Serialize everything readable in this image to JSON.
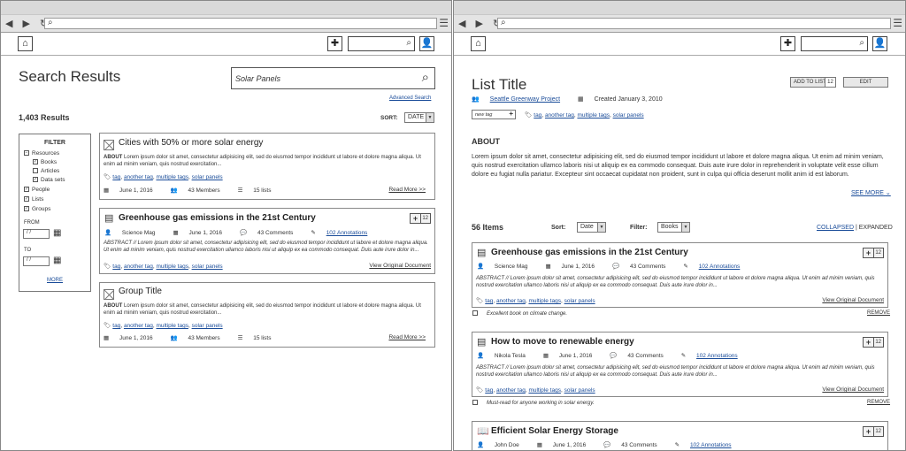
{
  "left": {
    "title": "Search Results",
    "search_value": "Solar Panels",
    "advanced_search": "Advanced Search",
    "results_count": "1,403 Results",
    "sort_label": "SORT:",
    "sort_value": "DATE",
    "filter": {
      "title": "FILTER",
      "items": [
        "Resources",
        "Books",
        "Articles",
        "Data sets",
        "People",
        "Lists",
        "Groups"
      ],
      "checked": [
        false,
        true,
        false,
        true,
        true,
        true,
        true
      ],
      "from": "FROM",
      "to": "TO",
      "date_placeholder": "/ /",
      "more": "MORE"
    },
    "results": [
      {
        "title": "Cities with 50% or more solar energy",
        "about": "ABOUT",
        "lorem": "Lorem ipsum dolor sit amet, consectetur adipisicing elit, sed do eiusmod tempor incididunt ut labore et dolore magna aliqua. Ut enim ad minim veniam, quis nostrud exercitation...",
        "tags": [
          "tag",
          "another tag",
          "multiple tags",
          "solar panels"
        ],
        "date": "June 1, 2016",
        "members": "43 Members",
        "lists": "15 lists",
        "action": "Read More >>"
      },
      {
        "title": "Greenhouse gas emissions in the 21st Century",
        "source": "Science Mag",
        "date": "June 1, 2016",
        "comments": "43 Comments",
        "annotations": "102 Annotations",
        "lorem": "ABSTRACT // Lorem ipsum dolor sit amet, consectetur adipisicing elit, sed do eiusmod tempor incididunt ut labore et dolore magna aliqua. Ut enim ad minim veniam, quis nostrud exercitation ullamco laboris nisi ut aliquip ex ea commodo consequat. Duis aute irure dolor in...",
        "tags": [
          "tag",
          "another tag",
          "multiple tags",
          "solar panels"
        ],
        "action": "View Original Document",
        "count": "12"
      },
      {
        "title": "Group Title",
        "about": "ABOUT",
        "lorem": "Lorem ipsum dolor sit amet, consectetur adipisicing elit, sed do eiusmod tempor incididunt ut labore et dolore magna aliqua. Ut enim ad minim veniam, quis nostrud exercitation...",
        "tags": [
          "tag",
          "another tag",
          "multiple tags",
          "solar panels"
        ],
        "date": "June 1, 2016",
        "members": "43 Members",
        "lists": "15 lists",
        "action": "Read More >>"
      }
    ]
  },
  "right": {
    "title": "List Title",
    "add_to_list": "ADD TO LIST",
    "add_count": "12",
    "edit": "EDIT",
    "owner": "Seattle Greenway Project",
    "created": "Created January 3, 2010",
    "new_tag": "new tag",
    "tags": [
      "tag",
      "another tag",
      "multiple tags",
      "solar panels"
    ],
    "about_title": "ABOUT",
    "about_text": "Lorem ipsum dolor sit amet, consectetur adipisicing elit, sed do eiusmod tempor incididunt ut labore et dolore magna aliqua. Ut enim ad minim veniam, quis nostrud exercitation ullamco laboris nisi ut aliquip ex ea commodo consequat. Duis aute irure dolor in reprehenderit in voluptate velit esse cillum dolore eu fugiat nulla pariatur. Excepteur sint occaecat cupidatat non proident, sunt in culpa qui officia deserunt mollit anim id est laborum.",
    "see_more": "SEE MORE",
    "items_count": "56 Items",
    "sort_label": "Sort:",
    "sort_value": "Date",
    "filter_label": "Filter:",
    "filter_value": "Books",
    "collapsed": "COLLAPSED",
    "sep": "|",
    "expanded": "EXPANDED",
    "items": [
      {
        "title": "Greenhouse gas emissions in the 21st Century",
        "author": "Science Mag",
        "date": "June 1, 2016",
        "comments": "43 Comments",
        "annotations": "102 Annotations",
        "lorem": "ABSTRACT // Lorem ipsum dolor sit amet, consectetur adipisicing elit, sed do eiusmod tempor incididunt ut labore et dolore magna aliqua. Ut enim ad minim veniam, quis nostrud exercitation ullamco laboris nisi ut aliquip ex ea commodo consequat. Duis aute irure dolor in...",
        "tags": [
          "tag",
          "another tag",
          "multiple tags",
          "solar panels"
        ],
        "action": "View Original Document",
        "count": "12",
        "note": "Excellent book on climate change.",
        "remove": "REMOVE"
      },
      {
        "title": "How to move to renewable energy",
        "author": "Nikola Tesla",
        "date": "June 1, 2016",
        "comments": "43 Comments",
        "annotations": "102 Annotations",
        "lorem": "ABSTRACT // Lorem ipsum dolor sit amet, consectetur adipisicing elit, sed do eiusmod tempor incididunt ut labore et dolore magna aliqua. Ut enim ad minim veniam, quis nostrud exercitation ullamco laboris nisi ut aliquip ex ea commodo consequat. Duis aute irure dolor in...",
        "tags": [
          "tag",
          "another tag",
          "multiple tags",
          "solar panels"
        ],
        "action": "View Original Document",
        "count": "12",
        "note": "Must-read for anyone working in solar energy.",
        "remove": "REMOVE"
      },
      {
        "title": "Efficient Solar Energy Storage",
        "author": "John Doe",
        "date": "June 1, 2016",
        "comments": "43 Comments",
        "annotations": "102 Annotations",
        "count": "12"
      }
    ]
  }
}
